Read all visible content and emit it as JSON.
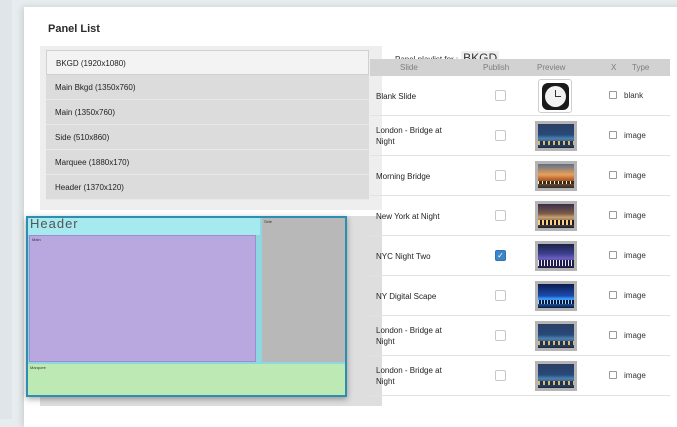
{
  "title": "Panel List",
  "panels": [
    {
      "label": "BKGD  (1920x1080)",
      "selected": true
    },
    {
      "label": "Main Bkgd  (1350x760)",
      "selected": false
    },
    {
      "label": "Main  (1350x760)",
      "selected": false
    },
    {
      "label": "Side  (510x860)",
      "selected": false
    },
    {
      "label": "Marquee  (1880x170)",
      "selected": false
    },
    {
      "label": "Header  (1370x120)",
      "selected": false
    }
  ],
  "layout_preview": {
    "header": "Header",
    "main": "Main",
    "side": "Side",
    "marquee": "Marquee"
  },
  "playlist": {
    "label": "Panel playlist for :",
    "panel_name": "BKGD",
    "columns": {
      "slide": "Slide",
      "publish": "Publish",
      "preview": "Preview",
      "x": "X",
      "type": "Type"
    },
    "rows": [
      {
        "slide": "Blank Slide",
        "published": false,
        "preview": "clock-icon",
        "type": "blank"
      },
      {
        "slide": "London - Bridge at Night",
        "published": false,
        "preview": "city-thumbnail",
        "type": "image"
      },
      {
        "slide": "Morning Bridge",
        "published": false,
        "preview": "sunset-thumbnail",
        "type": "image"
      },
      {
        "slide": "New York at Night",
        "published": false,
        "preview": "ny-thumbnail",
        "type": "image"
      },
      {
        "slide": "NYC Night Two",
        "published": true,
        "preview": "nyc2-thumbnail",
        "type": "image"
      },
      {
        "slide": "NY Digital Scape",
        "published": false,
        "preview": "digital-thumbnail",
        "type": "image"
      },
      {
        "slide": "London - Bridge at Night",
        "published": false,
        "preview": "city-thumbnail",
        "type": "image"
      },
      {
        "slide": "London - Bridge at Night",
        "published": false,
        "preview": "city-thumbnail",
        "type": "image"
      }
    ]
  },
  "colors": {
    "checkbox_on": "#3a86c8",
    "layout_border": "#2c8fb2",
    "header_region": "#a6e9ee",
    "main_region": "#b9a7df",
    "side_region": "#b8b8b8",
    "marquee_region": "#bde9b4"
  }
}
